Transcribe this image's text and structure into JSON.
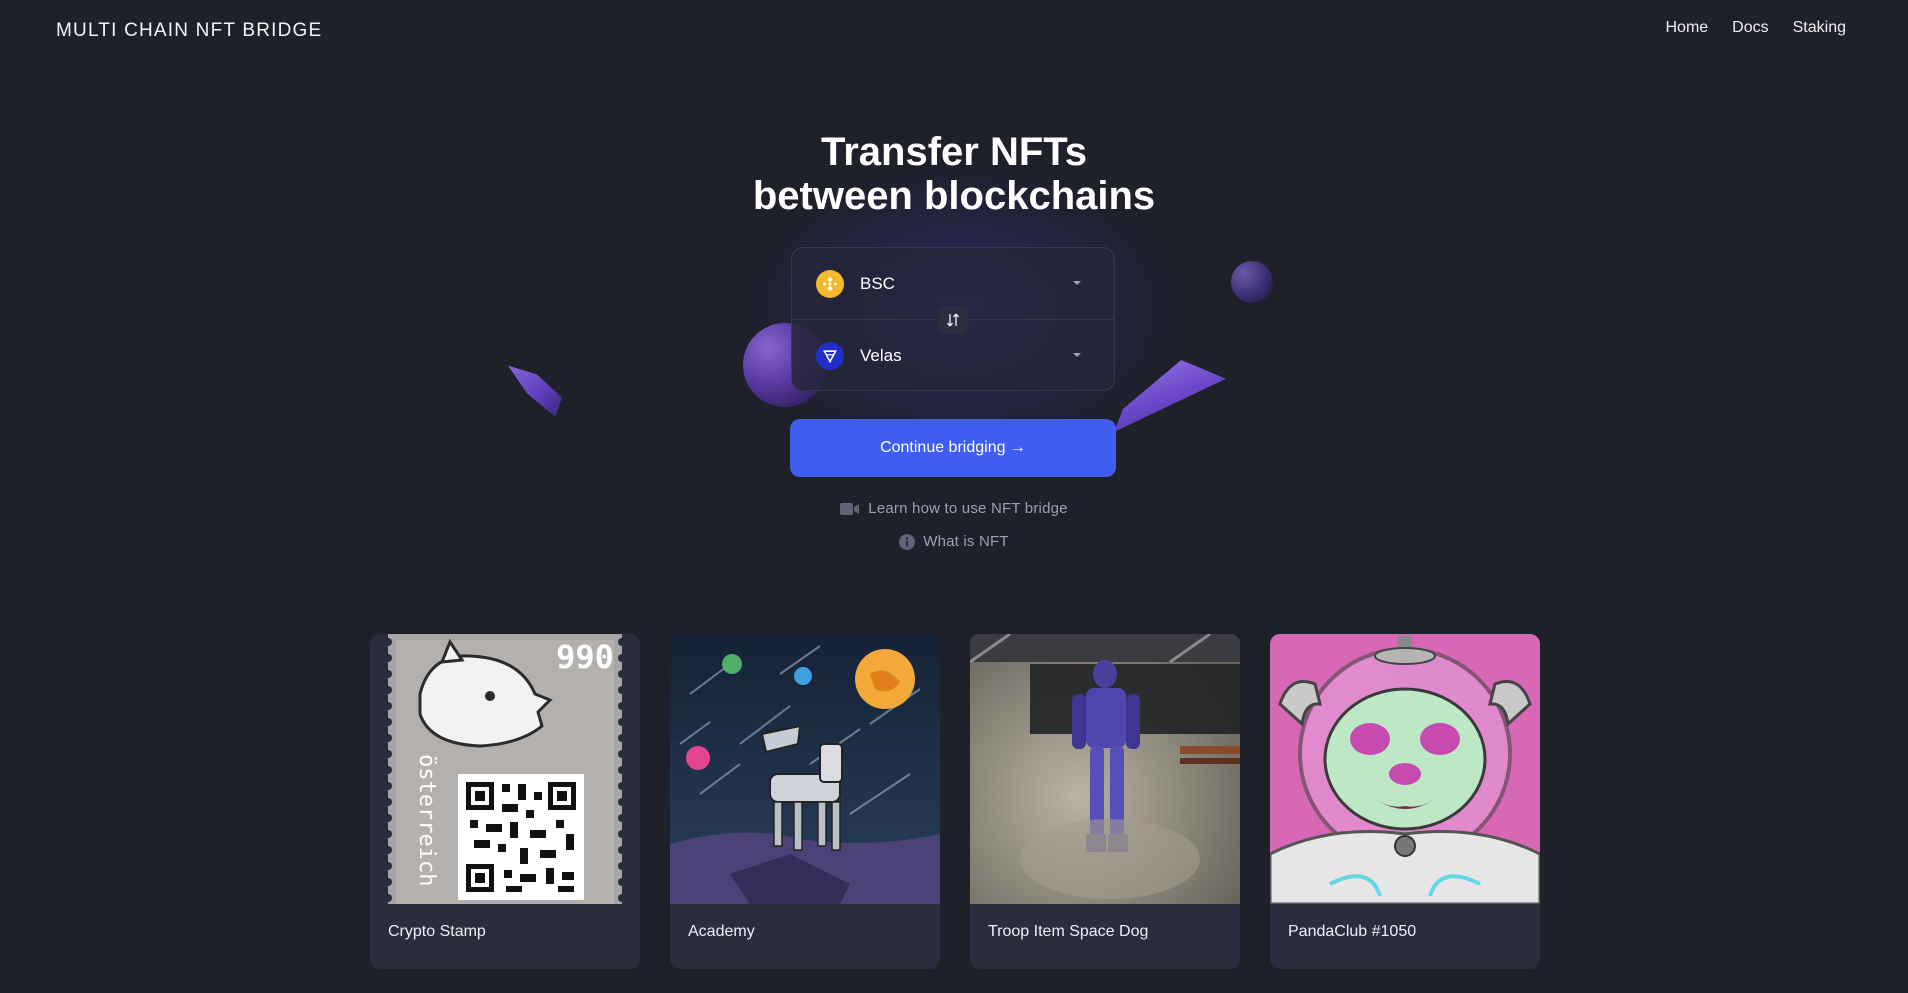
{
  "header": {
    "logo": "MULTI CHAIN NFT BRIDGE",
    "nav": [
      "Home",
      "Docs",
      "Staking"
    ]
  },
  "hero": {
    "title": "Transfer NFTs\nbetween blockchains"
  },
  "bridge": {
    "from_chain": {
      "name": "BSC",
      "icon": "bsc-icon"
    },
    "to_chain": {
      "name": "Velas",
      "icon": "velas-icon"
    },
    "swap_icon": "swap-arrows-icon",
    "cta_label": "Continue bridging →"
  },
  "help": {
    "learn_label": "Learn how to use NFT bridge",
    "learn_icon": "video-camera-icon",
    "what_label": "What is NFT",
    "what_icon": "info-icon"
  },
  "nfts": [
    {
      "name": "Crypto Stamp"
    },
    {
      "name": "Academy"
    },
    {
      "name": "Troop Item Space Dog"
    },
    {
      "name": "PandaClub #1050"
    }
  ],
  "stamp": {
    "value": "990",
    "country": "österreich"
  },
  "colors": {
    "background": "#1e202a",
    "accent": "#3f5ef0",
    "card": "#2a2d3e"
  }
}
